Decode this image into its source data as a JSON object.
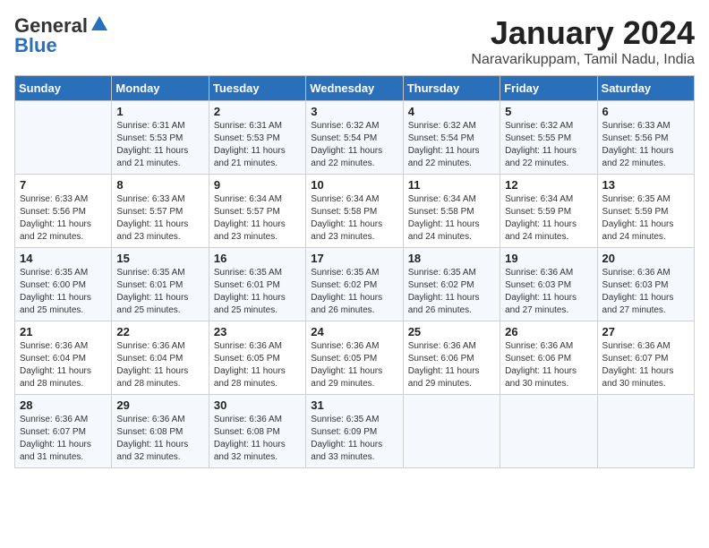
{
  "header": {
    "logo_line1": "General",
    "logo_line2": "Blue",
    "month": "January 2024",
    "location": "Naravarikuppam, Tamil Nadu, India"
  },
  "days_of_week": [
    "Sunday",
    "Monday",
    "Tuesday",
    "Wednesday",
    "Thursday",
    "Friday",
    "Saturday"
  ],
  "weeks": [
    [
      {
        "day": "",
        "info": ""
      },
      {
        "day": "1",
        "info": "Sunrise: 6:31 AM\nSunset: 5:53 PM\nDaylight: 11 hours\nand 21 minutes."
      },
      {
        "day": "2",
        "info": "Sunrise: 6:31 AM\nSunset: 5:53 PM\nDaylight: 11 hours\nand 21 minutes."
      },
      {
        "day": "3",
        "info": "Sunrise: 6:32 AM\nSunset: 5:54 PM\nDaylight: 11 hours\nand 22 minutes."
      },
      {
        "day": "4",
        "info": "Sunrise: 6:32 AM\nSunset: 5:54 PM\nDaylight: 11 hours\nand 22 minutes."
      },
      {
        "day": "5",
        "info": "Sunrise: 6:32 AM\nSunset: 5:55 PM\nDaylight: 11 hours\nand 22 minutes."
      },
      {
        "day": "6",
        "info": "Sunrise: 6:33 AM\nSunset: 5:56 PM\nDaylight: 11 hours\nand 22 minutes."
      }
    ],
    [
      {
        "day": "7",
        "info": "Sunrise: 6:33 AM\nSunset: 5:56 PM\nDaylight: 11 hours\nand 22 minutes."
      },
      {
        "day": "8",
        "info": "Sunrise: 6:33 AM\nSunset: 5:57 PM\nDaylight: 11 hours\nand 23 minutes."
      },
      {
        "day": "9",
        "info": "Sunrise: 6:34 AM\nSunset: 5:57 PM\nDaylight: 11 hours\nand 23 minutes."
      },
      {
        "day": "10",
        "info": "Sunrise: 6:34 AM\nSunset: 5:58 PM\nDaylight: 11 hours\nand 23 minutes."
      },
      {
        "day": "11",
        "info": "Sunrise: 6:34 AM\nSunset: 5:58 PM\nDaylight: 11 hours\nand 24 minutes."
      },
      {
        "day": "12",
        "info": "Sunrise: 6:34 AM\nSunset: 5:59 PM\nDaylight: 11 hours\nand 24 minutes."
      },
      {
        "day": "13",
        "info": "Sunrise: 6:35 AM\nSunset: 5:59 PM\nDaylight: 11 hours\nand 24 minutes."
      }
    ],
    [
      {
        "day": "14",
        "info": "Sunrise: 6:35 AM\nSunset: 6:00 PM\nDaylight: 11 hours\nand 25 minutes."
      },
      {
        "day": "15",
        "info": "Sunrise: 6:35 AM\nSunset: 6:01 PM\nDaylight: 11 hours\nand 25 minutes."
      },
      {
        "day": "16",
        "info": "Sunrise: 6:35 AM\nSunset: 6:01 PM\nDaylight: 11 hours\nand 25 minutes."
      },
      {
        "day": "17",
        "info": "Sunrise: 6:35 AM\nSunset: 6:02 PM\nDaylight: 11 hours\nand 26 minutes."
      },
      {
        "day": "18",
        "info": "Sunrise: 6:35 AM\nSunset: 6:02 PM\nDaylight: 11 hours\nand 26 minutes."
      },
      {
        "day": "19",
        "info": "Sunrise: 6:36 AM\nSunset: 6:03 PM\nDaylight: 11 hours\nand 27 minutes."
      },
      {
        "day": "20",
        "info": "Sunrise: 6:36 AM\nSunset: 6:03 PM\nDaylight: 11 hours\nand 27 minutes."
      }
    ],
    [
      {
        "day": "21",
        "info": "Sunrise: 6:36 AM\nSunset: 6:04 PM\nDaylight: 11 hours\nand 28 minutes."
      },
      {
        "day": "22",
        "info": "Sunrise: 6:36 AM\nSunset: 6:04 PM\nDaylight: 11 hours\nand 28 minutes."
      },
      {
        "day": "23",
        "info": "Sunrise: 6:36 AM\nSunset: 6:05 PM\nDaylight: 11 hours\nand 28 minutes."
      },
      {
        "day": "24",
        "info": "Sunrise: 6:36 AM\nSunset: 6:05 PM\nDaylight: 11 hours\nand 29 minutes."
      },
      {
        "day": "25",
        "info": "Sunrise: 6:36 AM\nSunset: 6:06 PM\nDaylight: 11 hours\nand 29 minutes."
      },
      {
        "day": "26",
        "info": "Sunrise: 6:36 AM\nSunset: 6:06 PM\nDaylight: 11 hours\nand 30 minutes."
      },
      {
        "day": "27",
        "info": "Sunrise: 6:36 AM\nSunset: 6:07 PM\nDaylight: 11 hours\nand 30 minutes."
      }
    ],
    [
      {
        "day": "28",
        "info": "Sunrise: 6:36 AM\nSunset: 6:07 PM\nDaylight: 11 hours\nand 31 minutes."
      },
      {
        "day": "29",
        "info": "Sunrise: 6:36 AM\nSunset: 6:08 PM\nDaylight: 11 hours\nand 32 minutes."
      },
      {
        "day": "30",
        "info": "Sunrise: 6:36 AM\nSunset: 6:08 PM\nDaylight: 11 hours\nand 32 minutes."
      },
      {
        "day": "31",
        "info": "Sunrise: 6:35 AM\nSunset: 6:09 PM\nDaylight: 11 hours\nand 33 minutes."
      },
      {
        "day": "",
        "info": ""
      },
      {
        "day": "",
        "info": ""
      },
      {
        "day": "",
        "info": ""
      }
    ]
  ]
}
